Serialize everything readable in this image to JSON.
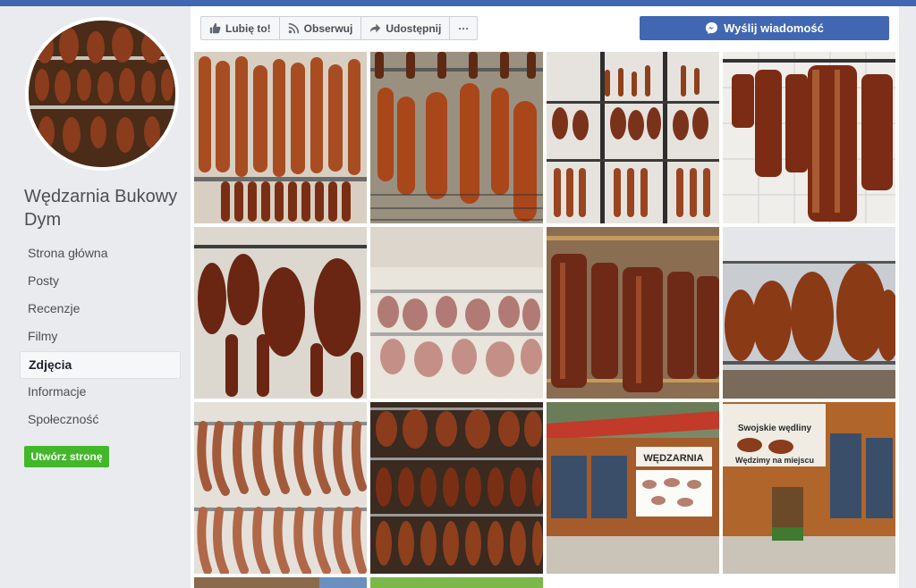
{
  "page": {
    "name": "Wędzarnia Bukowy Dym"
  },
  "sidebar": {
    "items": [
      {
        "label": "Strona główna",
        "active": false
      },
      {
        "label": "Posty",
        "active": false
      },
      {
        "label": "Recenzje",
        "active": false
      },
      {
        "label": "Filmy",
        "active": false
      },
      {
        "label": "Zdjęcia",
        "active": true
      },
      {
        "label": "Informacje",
        "active": false
      },
      {
        "label": "Społeczność",
        "active": false
      }
    ],
    "create_page_label": "Utwórz stronę"
  },
  "actions": {
    "like_label": "Lubię to!",
    "follow_label": "Obserwuj",
    "share_label": "Udostępnij",
    "more_label": "···",
    "message_label": "Wyślij wiadomość",
    "like_icon": "thumbs-up-icon",
    "follow_icon": "rss-icon",
    "share_icon": "share-arrow-icon",
    "message_icon": "messenger-icon"
  },
  "photos": [
    {
      "subject": "sausages"
    },
    {
      "subject": "sausages"
    },
    {
      "subject": "rack"
    },
    {
      "subject": "bacon"
    },
    {
      "subject": "hams"
    },
    {
      "subject": "raw-meat"
    },
    {
      "subject": "bacon"
    },
    {
      "subject": "hams"
    },
    {
      "subject": "sausage-loops"
    },
    {
      "subject": "rack"
    },
    {
      "subject": "shop-front"
    },
    {
      "subject": "shop-front-2"
    },
    {
      "subject": "partial"
    },
    {
      "subject": "partial-green"
    }
  ],
  "photo_signs": {
    "shop_sign": "WĘDZARNIA",
    "banner_top": "Swojskie wędliny",
    "banner_bottom": "Wędzimy na miejscu"
  },
  "colors": {
    "brand_blue": "#4267b2",
    "create_green": "#42b72a",
    "smoked_meat": "#8a3c1c"
  }
}
